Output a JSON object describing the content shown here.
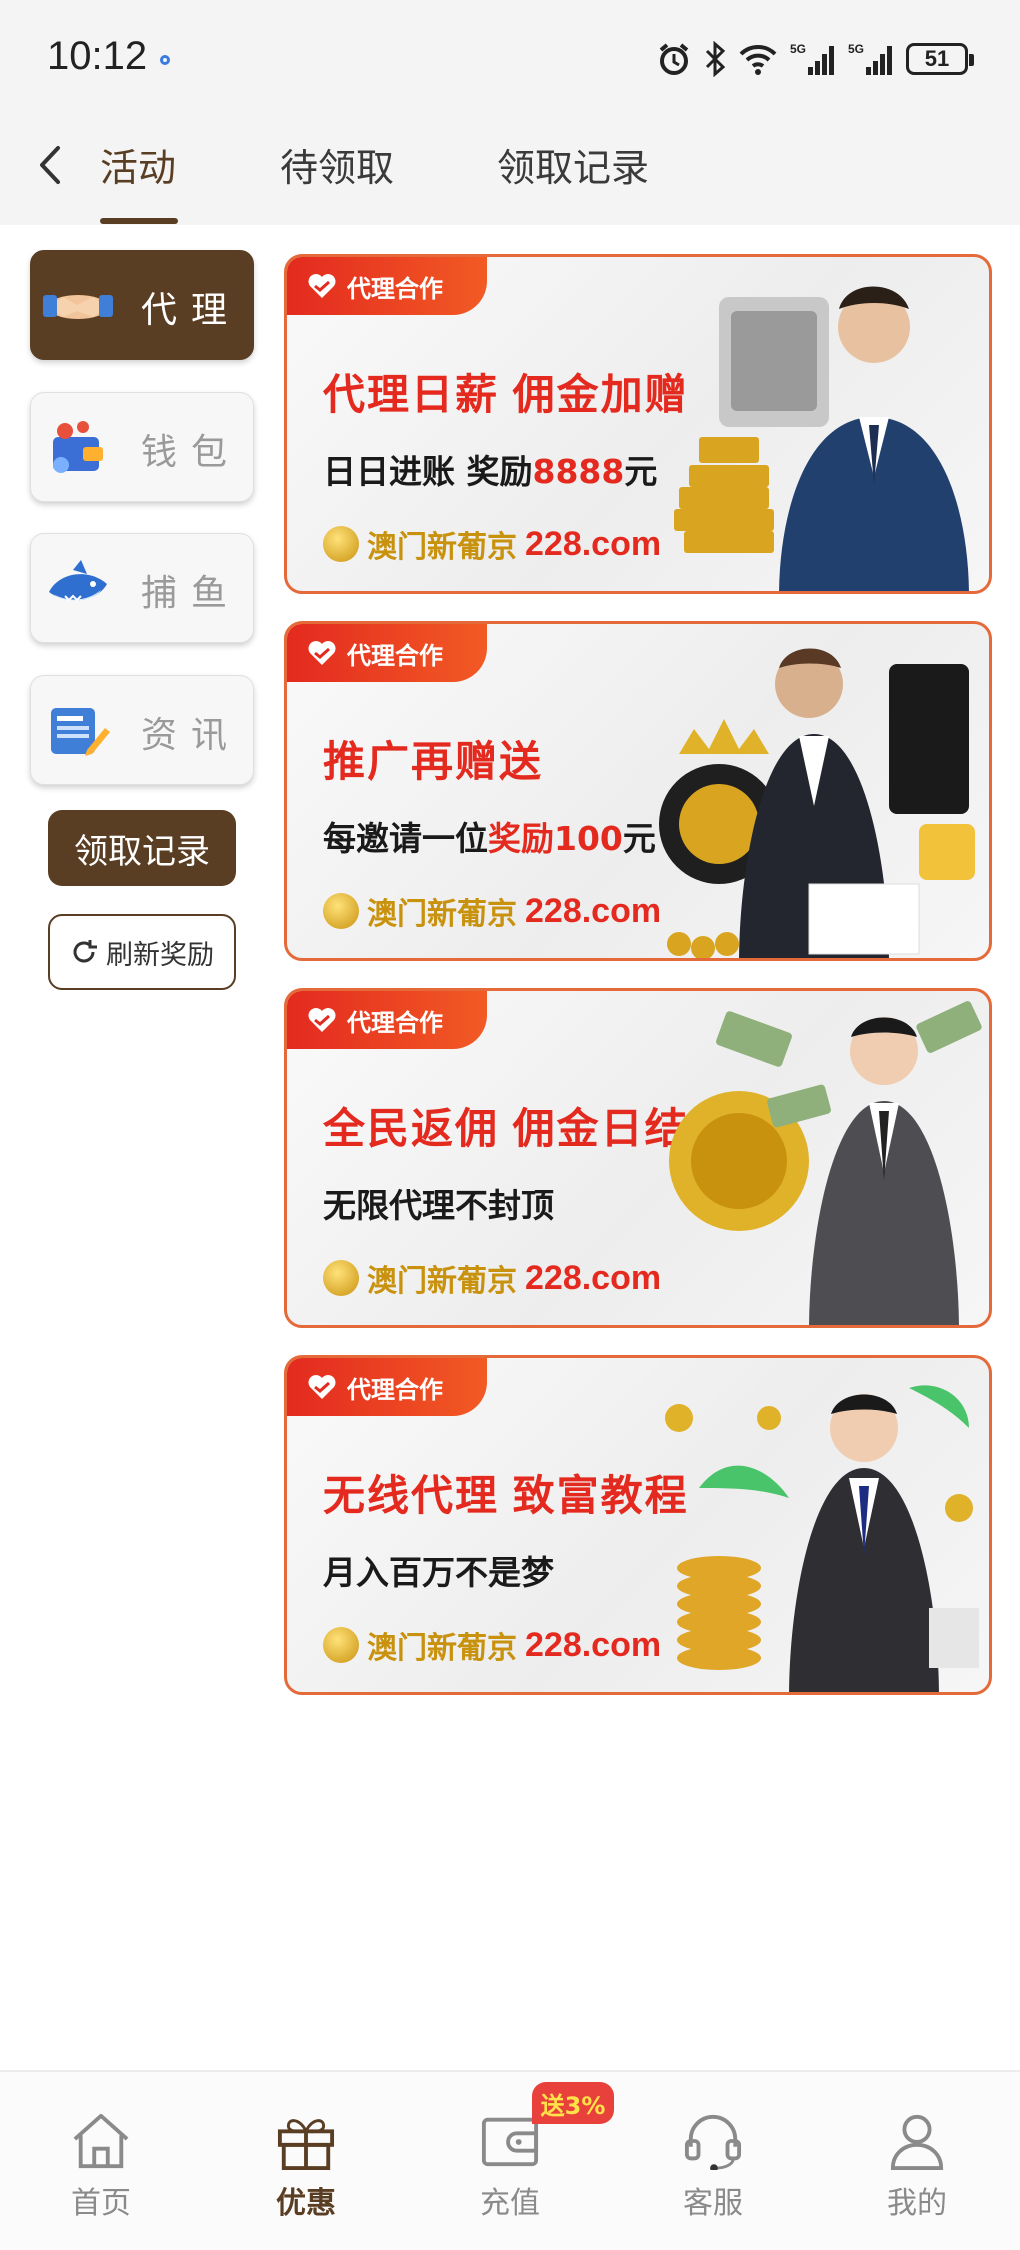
{
  "status_bar": {
    "time": "10:12",
    "battery": "51"
  },
  "top_nav": {
    "tabs": [
      {
        "label": "活动"
      },
      {
        "label": "待领取"
      },
      {
        "label": "领取记录"
      }
    ]
  },
  "side_menu": {
    "items": [
      {
        "label": "代理",
        "icon": "handshake-icon"
      },
      {
        "label": "钱包",
        "icon": "wallet-icon"
      },
      {
        "label": "捕鱼",
        "icon": "shark-icon"
      },
      {
        "label": "资讯",
        "icon": "news-icon"
      }
    ],
    "claim_records_label": "领取记录",
    "refresh_label": "刷新奖励"
  },
  "banners": [
    {
      "badge": "代理合作",
      "title": "代理日薪 佣金加赠",
      "sub_pre": "日日进账 奖励",
      "sub_hl": "8888",
      "sub_post": "元",
      "brand": "澳门新葡京",
      "domain": "228.com"
    },
    {
      "badge": "代理合作",
      "title": "推广再赠送",
      "sub_pre": "每邀请一位",
      "sub_hl": "奖励100",
      "sub_post": "元",
      "brand": "澳门新葡京",
      "domain": "228.com"
    },
    {
      "badge": "代理合作",
      "title": "全民返佣 佣金日结",
      "sub_pre": "无限代理不封顶",
      "sub_hl": "",
      "sub_post": "",
      "brand": "澳门新葡京",
      "domain": "228.com"
    },
    {
      "badge": "代理合作",
      "title": "无线代理 致富教程",
      "sub_pre": "月入百万不是梦",
      "sub_hl": "",
      "sub_post": "",
      "brand": "澳门新葡京",
      "domain": "228.com"
    }
  ],
  "bottom_nav": {
    "items": [
      {
        "label": "首页",
        "icon": "home-icon"
      },
      {
        "label": "优惠",
        "icon": "gift-icon"
      },
      {
        "label": "充值",
        "icon": "wallet-icon"
      },
      {
        "label": "客服",
        "icon": "headset-icon"
      },
      {
        "label": "我的",
        "icon": "user-icon"
      }
    ],
    "recharge_bonus": "送3%"
  },
  "colors": {
    "accent_brown": "#5a3e24",
    "banner_red": "#e42a1f",
    "banner_border": "#e56a3a",
    "brand_gold": "#c9920e"
  }
}
